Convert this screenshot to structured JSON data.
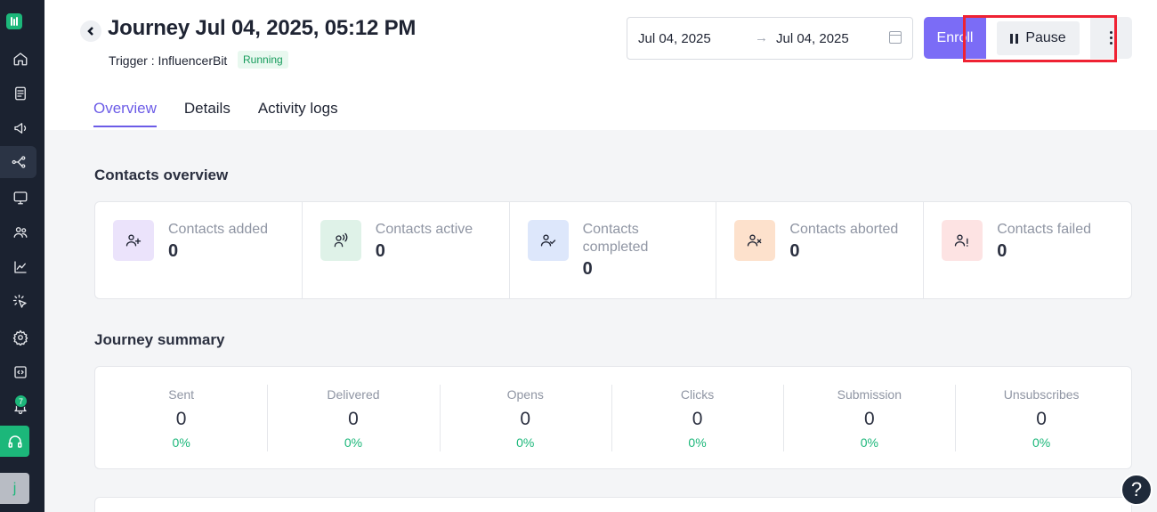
{
  "header": {
    "title": "Journey Jul 04, 2025, 05:12 PM",
    "trigger": "Trigger : InfluencerBit",
    "status": "Running",
    "date_from": "Jul 04, 2025",
    "date_to": "Jul 04, 2025",
    "enroll_label": "Enroll",
    "pause_label": "Pause"
  },
  "tabs": [
    "Overview",
    "Details",
    "Activity logs"
  ],
  "active_tab": "Overview",
  "contacts_overview": {
    "title": "Contacts overview",
    "items": [
      {
        "label": "Contacts added",
        "value": "0",
        "icon": "user-plus-icon",
        "color": "#ebe3fb"
      },
      {
        "label": "Contacts active",
        "value": "0",
        "icon": "user-signal-icon",
        "color": "#dff2e8"
      },
      {
        "label": "Contacts completed",
        "value": "0",
        "icon": "user-check-icon",
        "color": "#dde7fb"
      },
      {
        "label": "Contacts aborted",
        "value": "0",
        "icon": "user-x-icon",
        "color": "#fde1cc"
      },
      {
        "label": "Contacts failed",
        "value": "0",
        "icon": "user-alert-icon",
        "color": "#fde3e3"
      }
    ]
  },
  "journey_summary": {
    "title": "Journey summary",
    "items": [
      {
        "label": "Sent",
        "value": "0",
        "percent": "0%"
      },
      {
        "label": "Delivered",
        "value": "0",
        "percent": "0%"
      },
      {
        "label": "Opens",
        "value": "0",
        "percent": "0%"
      },
      {
        "label": "Clicks",
        "value": "0",
        "percent": "0%"
      },
      {
        "label": "Submission",
        "value": "0",
        "percent": "0%"
      },
      {
        "label": "Unsubscribes",
        "value": "0",
        "percent": "0%"
      }
    ]
  },
  "sidebar": {
    "notification_count": "7",
    "avatar_initial": "j"
  },
  "help_label": "?",
  "colors": {
    "accent": "#7b6cf6",
    "tab_active": "#6c5ce7",
    "success": "#1cb77a",
    "sidebar_bg": "#1b2230",
    "highlight": "#ef2233"
  }
}
